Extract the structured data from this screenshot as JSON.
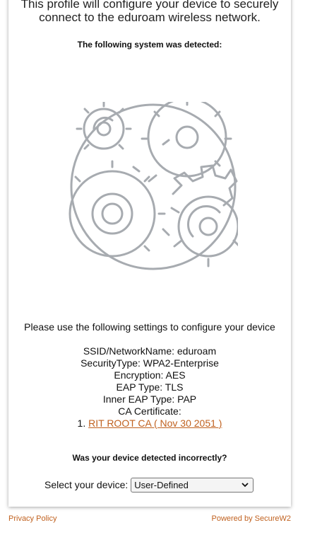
{
  "intro": {
    "line1": "This profile will configure your device to securely",
    "line2": "connect to the eduroam wireless network."
  },
  "detected_label": "The following system was detected:",
  "instructions": "Please use the following settings to configure your device",
  "settings": {
    "ssid": "SSID/NetworkName: eduroam",
    "security": "SecurityType: WPA2-Enterprise",
    "encryption": "Encryption: AES",
    "eap": "EAP Type: TLS",
    "inner_eap": "Inner EAP Type: PAP",
    "ca_label": "CA Certificate:",
    "cert_number": "1.",
    "cert_link": "RIT ROOT CA ( Nov 30 2051 )"
  },
  "incorrect_label": "Was your device detected incorrectly?",
  "device_select": {
    "label": "Select your device:",
    "selected": "User-Defined"
  },
  "footer": {
    "privacy": "Privacy Policy",
    "powered": "Powered by SecureW2"
  },
  "colors": {
    "link": "#c0611f",
    "gear_stroke": "#a7abb0"
  },
  "icons": {
    "hero": "gears-in-circle-icon",
    "select_arrow": "chevron-down-icon"
  }
}
